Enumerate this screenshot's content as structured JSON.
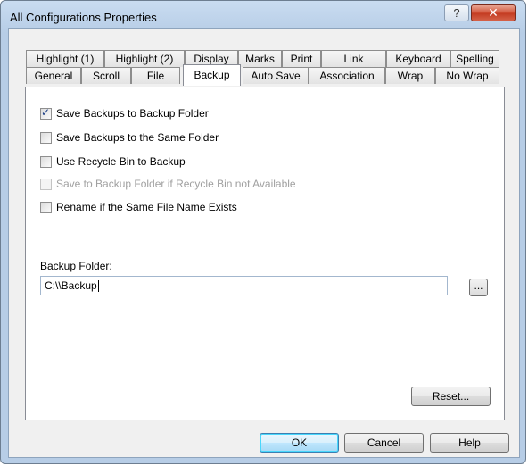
{
  "window": {
    "title": "All Configurations Properties",
    "help_glyph": "?",
    "close_glyph": "✕"
  },
  "tabs_row1": [
    "Highlight (1)",
    "Highlight (2)",
    "Display",
    "Marks",
    "Print",
    "Link",
    "Keyboard",
    "Spelling"
  ],
  "tabs_row2": [
    "General",
    "Scroll",
    "File",
    "Backup",
    "Auto Save",
    "Association",
    "Wrap",
    "No Wrap"
  ],
  "active_tab": "Backup",
  "options": [
    {
      "label": "Save Backups to Backup Folder",
      "checked": true,
      "enabled": true
    },
    {
      "label": "Save Backups to the Same Folder",
      "checked": false,
      "enabled": true
    },
    {
      "label": "Use Recycle Bin to Backup",
      "checked": false,
      "enabled": true
    },
    {
      "label": "Save to Backup Folder if Recycle Bin not Available",
      "checked": false,
      "enabled": false
    },
    {
      "label": "Rename if the Same File Name Exists",
      "checked": false,
      "enabled": true
    }
  ],
  "backup_folder": {
    "label": "Backup Folder:",
    "value": "C:\\\\Backup",
    "browse_label": "..."
  },
  "buttons": {
    "reset": "Reset...",
    "ok": "OK",
    "cancel": "Cancel",
    "help": "Help"
  },
  "colors": {
    "title_bar": "#c9dcf1",
    "close_button": "#c33a20",
    "default_button_border": "#3c7fb1",
    "check_mark": "#1c3f86"
  },
  "icons": {
    "help": "question-mark",
    "close": "x-mark",
    "checkbox": "checkbox"
  }
}
